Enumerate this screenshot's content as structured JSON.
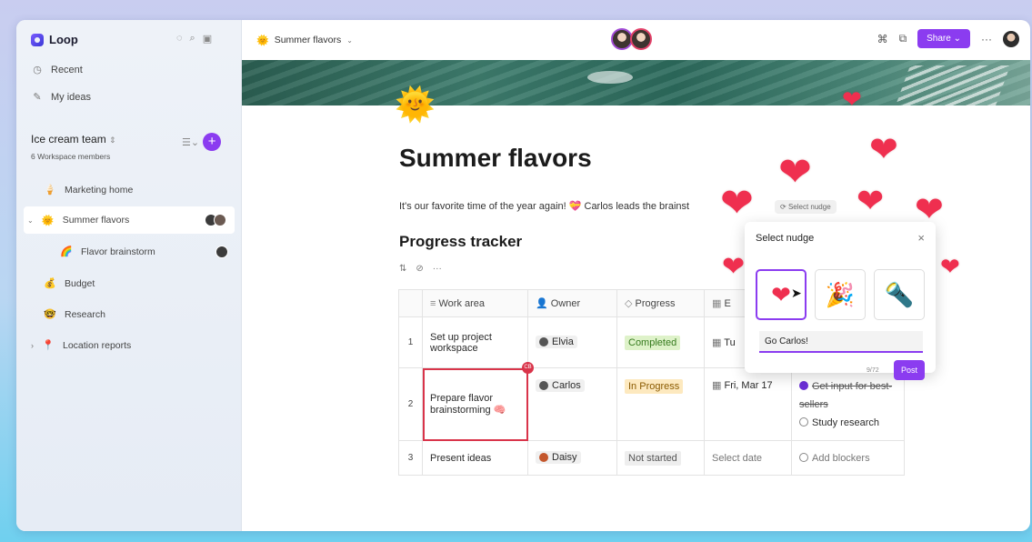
{
  "sidebar": {
    "app_name": "Loop",
    "nav": [
      {
        "label": "Recent",
        "icon": "clock-icon"
      },
      {
        "label": "My ideas",
        "icon": "idea-icon"
      }
    ],
    "workspace": {
      "title": "Ice cream team",
      "subtitle": "6 Workspace members"
    },
    "pages": [
      {
        "label": "Marketing home",
        "icon": "ice-cream-icon"
      },
      {
        "label": "Summer flavors",
        "icon": "sun-icon"
      },
      {
        "label": "Flavor brainstorm",
        "icon": "rainbow-icon"
      },
      {
        "label": "Budget",
        "icon": "money-bag-icon"
      },
      {
        "label": "Research",
        "icon": "research-icon"
      },
      {
        "label": "Location reports",
        "icon": "location-icon"
      }
    ]
  },
  "topbar": {
    "breadcrumb": "Summer flavors",
    "share_label": "Share"
  },
  "page": {
    "title": "Summer flavors",
    "intro": "It's our favorite time of the year again! 💝 Carlos leads the brainst",
    "select_nudge_chip": "Select nudge",
    "section_title": "Progress tracker"
  },
  "table": {
    "headers": [
      "Work area",
      "Owner",
      "Progress",
      "E"
    ],
    "rows": [
      {
        "num": "1",
        "work": "Set up project workspace",
        "owner": "Elvia",
        "progress": "Completed",
        "date": "Tu",
        "blocker": ""
      },
      {
        "num": "2",
        "work": "Prepare flavor brainstorming",
        "owner": "Carlos",
        "progress": "In Progress",
        "date": "Fri, Mar 17",
        "blocker": "Get input for best-sellers",
        "blocker2": "Study research"
      },
      {
        "num": "3",
        "work": "Present ideas",
        "owner": "Daisy",
        "progress": "Not started",
        "date": "Select date",
        "blocker": "Add blockers"
      }
    ]
  },
  "nudge": {
    "title": "Select nudge",
    "options": [
      "heart",
      "party-popper",
      "flashlight"
    ],
    "input_value": "Go Carlos!",
    "counter": "9/72",
    "post_label": "Post"
  },
  "colors": {
    "accent": "#8b3cf0",
    "heart": "#ef2f4f"
  }
}
